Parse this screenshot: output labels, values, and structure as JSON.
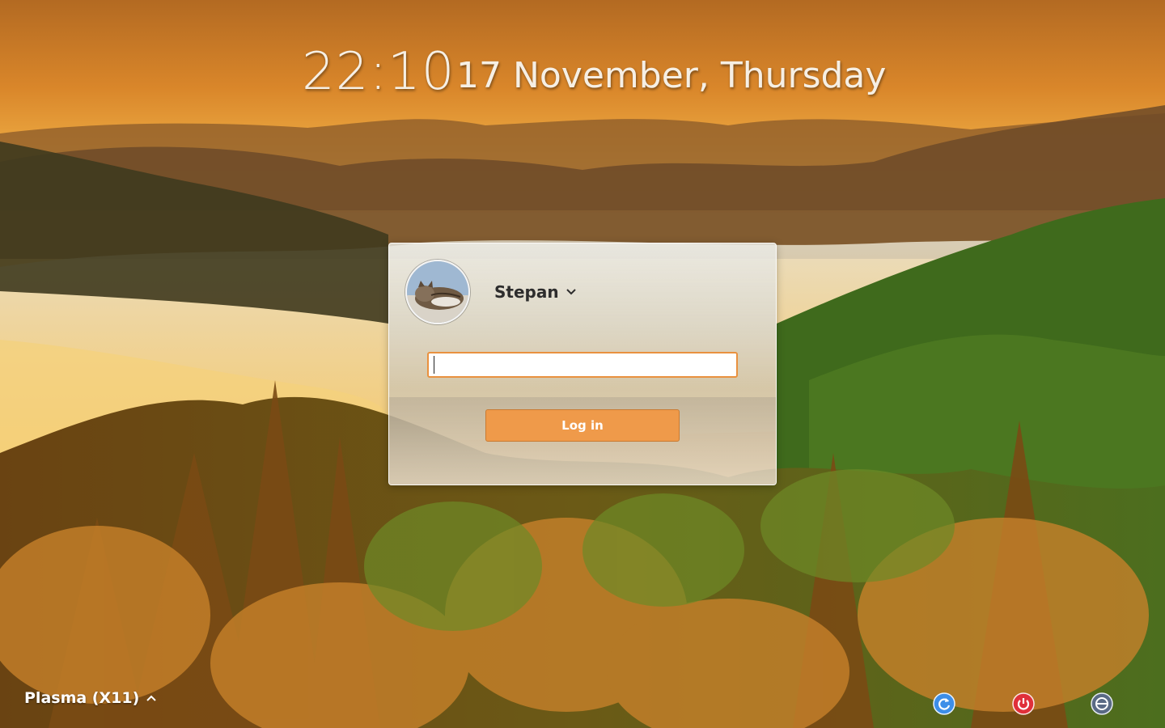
{
  "clock": {
    "time": "22:10",
    "date": "17 November, Thursday"
  },
  "user": {
    "name": "Stepan"
  },
  "password_field": {
    "value": "",
    "placeholder": ""
  },
  "login_button": {
    "label": "Log in"
  },
  "session": {
    "label": "Plasma (X11)"
  },
  "actions": [
    {
      "name": "restart",
      "icon": "restart-icon",
      "color": "#3d8ee8"
    },
    {
      "name": "shutdown",
      "icon": "power-icon",
      "color": "#e0303a"
    },
    {
      "name": "switch-user",
      "icon": "block-icon",
      "color": "#5a6a85"
    }
  ],
  "colors": {
    "accent": "#ef9a4a",
    "field_border": "#e9913f"
  }
}
